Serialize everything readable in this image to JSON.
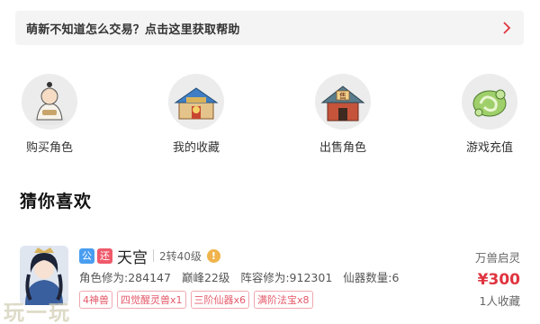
{
  "help": {
    "text": "萌新不知道怎么交易？点击这里获取帮助"
  },
  "nav": {
    "items": [
      {
        "label": "购买角色",
        "icon": "buy-character-icon"
      },
      {
        "label": "我的收藏",
        "icon": "my-favorites-icon"
      },
      {
        "label": "出售角色",
        "icon": "sell-character-icon"
      },
      {
        "label": "游戏充值",
        "icon": "game-recharge-icon"
      }
    ]
  },
  "section": {
    "title": "猜你喜欢"
  },
  "listing": {
    "tag_public": "公",
    "tag_return": "还",
    "name": "天宫",
    "level": "2转40级",
    "cultivation": "角色修为:284147",
    "peak": "巅峰22级",
    "formation": "阵容修为:912301",
    "fairy_count": "仙器数量:6",
    "chips": [
      "4神兽",
      "四觉醒灵兽x1",
      "三阶仙器x6",
      "满阶法宝x8"
    ],
    "server": "万兽启灵",
    "price": "¥300",
    "favorites": "1人收藏"
  },
  "watermark": {
    "text": "玩一玩"
  },
  "colors": {
    "accent_red": "#e0343f",
    "tag_blue": "#4a9ef0",
    "tag_red": "#ef5a6b",
    "help_bg": "#f4f4f4"
  }
}
